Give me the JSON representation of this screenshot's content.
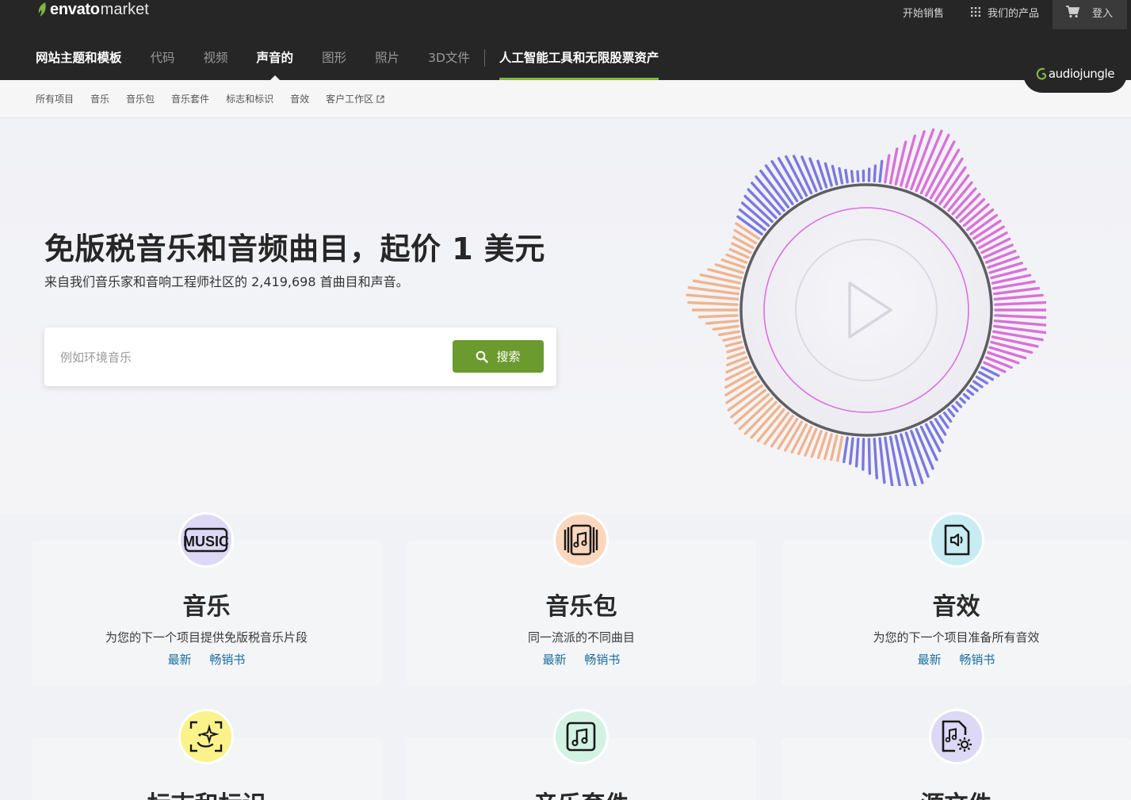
{
  "brand": {
    "name": "envato",
    "suffix": "market",
    "accent": "#82b541"
  },
  "utility": {
    "sell": "开始销售",
    "products": "我们的产品",
    "signin": "登入"
  },
  "main_nav": [
    {
      "label": "网站主题和模板",
      "state": "bold"
    },
    {
      "label": "代码",
      "state": ""
    },
    {
      "label": "视频",
      "state": ""
    },
    {
      "label": "声音的",
      "state": "active"
    },
    {
      "label": "图形",
      "state": ""
    },
    {
      "label": "照片",
      "state": ""
    },
    {
      "label": "3D文件",
      "state": ""
    }
  ],
  "ai_link": "人工智能工具和无限股票资产",
  "site_badge": "audiojungle",
  "sub_nav": [
    "所有项目",
    "音乐",
    "音乐包",
    "音乐套件",
    "标志和标识",
    "音效",
    "客户工作区"
  ],
  "hero": {
    "title": "免版税音乐和音频曲目，起价 1 美元",
    "lead": "来自我们音乐家和音响工程师社区的 2,419,698 首曲目和声音。",
    "search_placeholder": "例如环境音乐",
    "search_button": "搜索"
  },
  "categories": [
    {
      "title": "音乐",
      "desc": "为您的下一个项目提供免版税音乐片段",
      "link_new": "最新",
      "link_best": "畅销书",
      "icon": "music-icon",
      "color": "#ddd8f5"
    },
    {
      "title": "音乐包",
      "desc": "同一流派的不同曲目",
      "link_new": "最新",
      "link_best": "畅销书",
      "icon": "album-icon",
      "color": "#fcd7bd"
    },
    {
      "title": "音效",
      "desc": "为您的下一个项目准备所有音效",
      "link_new": "最新",
      "link_best": "畅销书",
      "icon": "sound-file-icon",
      "color": "#c9ecf3"
    },
    {
      "title": "标志和标识",
      "icon": "sparkle-icon",
      "color": "#fbf28b"
    },
    {
      "title": "音乐套件",
      "icon": "music-note-icon",
      "color": "#d2f2e4"
    },
    {
      "title": "源文件",
      "icon": "file-settings-icon",
      "color": "#ddd8f5"
    }
  ]
}
